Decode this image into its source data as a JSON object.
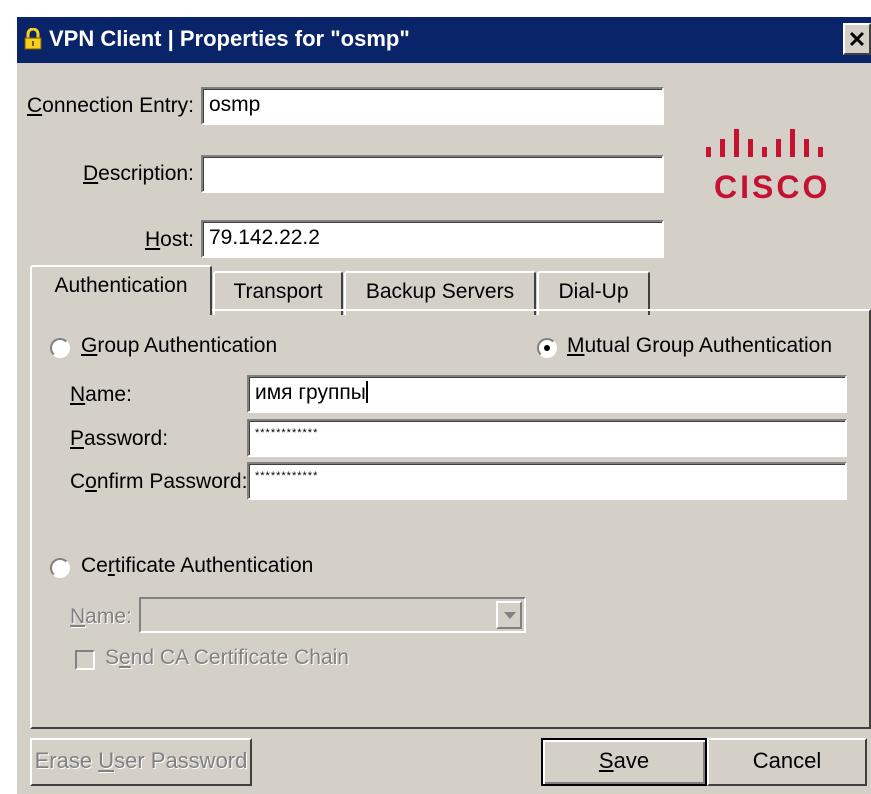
{
  "window": {
    "title": "VPN Client  |  Properties for \"osmp\"",
    "close_glyph": "✕"
  },
  "connection": {
    "entry_label": "Connection Entry:",
    "entry_value": "osmp",
    "description_label": "Description:",
    "description_value": "",
    "host_label": "Host:",
    "host_value": "79.142.22.2"
  },
  "logo": {
    "bars_glyph": "ılıılı",
    "text": "CISCO",
    "color": "#c41230"
  },
  "tabs": [
    {
      "label": "Authentication",
      "active": true
    },
    {
      "label": "Transport",
      "active": false
    },
    {
      "label": "Backup Servers",
      "active": false
    },
    {
      "label": "Dial-Up",
      "active": false
    }
  ],
  "auth": {
    "group_auth_label": "Group Authentication",
    "mutual_group_auth_label": "Mutual Group Authentication",
    "selected": "mutual",
    "name_label": "Name:",
    "name_value": "имя группы",
    "password_label": "Password:",
    "password_value": "************",
    "confirm_label": "Confirm Password:",
    "confirm_value": "************",
    "cert_auth_label": "Certificate Authentication",
    "cert_name_label": "Name:",
    "cert_name_value": "",
    "send_ca_label": "Send CA Certificate Chain"
  },
  "buttons": {
    "erase": "Erase User Password",
    "save": "Save",
    "cancel": "Cancel"
  },
  "colors": {
    "titlebar": "#0a246a",
    "dialog": "#d4d0c8"
  }
}
